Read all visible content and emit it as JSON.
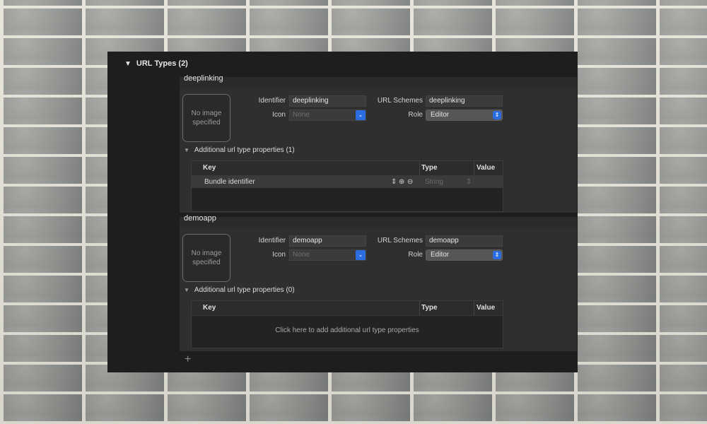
{
  "section": {
    "title": "URL Types (2)"
  },
  "url_types": [
    {
      "name": "deeplinking",
      "image_placeholder": "No image specified",
      "identifier_label": "Identifier",
      "identifier_value": "deeplinking",
      "icon_label": "Icon",
      "icon_placeholder": "None",
      "schemes_label": "URL Schemes",
      "schemes_value": "deeplinking",
      "role_label": "Role",
      "role_value": "Editor",
      "additional_title": "Additional url type properties (1)",
      "table": {
        "headers": {
          "key": "Key",
          "type": "Type",
          "value": "Value"
        },
        "rows": [
          {
            "key": "Bundle identifier",
            "type": "String",
            "value": ""
          }
        ]
      }
    },
    {
      "name": "demoapp",
      "image_placeholder": "No image specified",
      "identifier_label": "Identifier",
      "identifier_value": "demoapp",
      "icon_label": "Icon",
      "icon_placeholder": "None",
      "schemes_label": "URL Schemes",
      "schemes_value": "demoapp",
      "role_label": "Role",
      "role_value": "Editor",
      "additional_title": "Additional url type properties (0)",
      "table": {
        "headers": {
          "key": "Key",
          "type": "Type",
          "value": "Value"
        },
        "empty_message": "Click here to add additional url type properties"
      }
    }
  ],
  "add_symbol": "+",
  "colors": {
    "panel_bg": "#1e1e1e",
    "accent": "#2a6de0"
  }
}
